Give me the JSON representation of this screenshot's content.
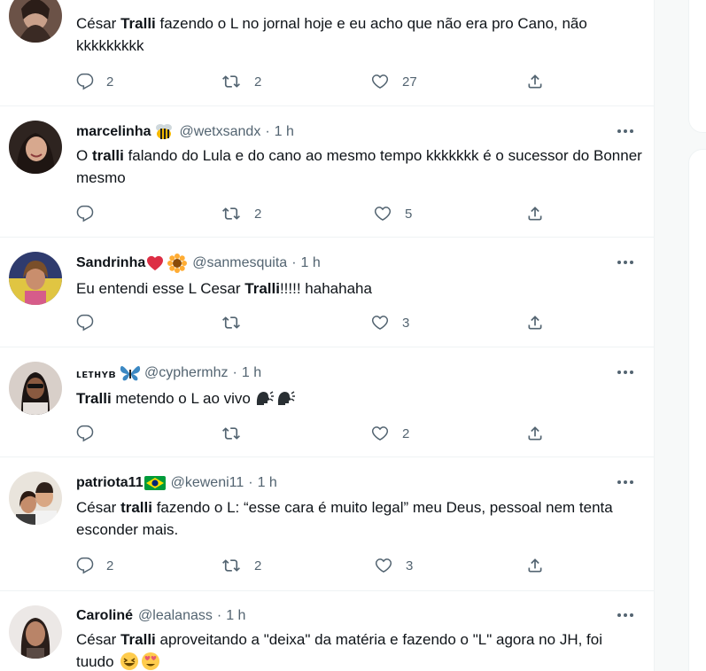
{
  "tweets": [
    {
      "name": "",
      "handle": "",
      "time": "",
      "text_parts": [
        {
          "t": "César ",
          "b": false
        },
        {
          "t": "Tralli",
          "b": true
        },
        {
          "t": " fazendo o L no jornal hoje e eu acho que não era pro Cano, não kkkkkkkkk",
          "b": false
        }
      ],
      "replies": "2",
      "retweets": "2",
      "likes": "27"
    },
    {
      "name": "marcelinha",
      "name_emoji": "bee",
      "handle": "@wetxsandx",
      "time": "1 h",
      "text_parts": [
        {
          "t": "O ",
          "b": false
        },
        {
          "t": "tralli",
          "b": true
        },
        {
          "t": " falando do Lula e do cano ao mesmo tempo kkkkkkk é o sucessor do Bonner mesmo",
          "b": false
        }
      ],
      "replies": "",
      "retweets": "2",
      "likes": "5"
    },
    {
      "name": "Sandrinha",
      "name_emoji": "heart-sunflower",
      "handle": "@sanmesquita",
      "time": "1 h",
      "text_parts": [
        {
          "t": "Eu entendi esse L Cesar ",
          "b": false
        },
        {
          "t": "Tralli",
          "b": true
        },
        {
          "t": "!!!!! hahahaha",
          "b": false
        }
      ],
      "replies": "",
      "retweets": "",
      "likes": "3"
    },
    {
      "name": "ʟᴇᴛʜʏʙ",
      "name_emoji": "butterfly",
      "handle": "@cyphermhz",
      "time": "1 h",
      "text_parts": [
        {
          "t": "Tralli",
          "b": true
        },
        {
          "t": " metendo o L ao vivo",
          "b": false
        }
      ],
      "text_emoji": "speaking-head",
      "replies": "",
      "retweets": "",
      "likes": "2"
    },
    {
      "name": "patriota11",
      "name_emoji": "brazil-flag",
      "handle": "@keweni11",
      "time": "1 h",
      "text_parts": [
        {
          "t": "César ",
          "b": false
        },
        {
          "t": "tralli",
          "b": true
        },
        {
          "t": " fazendo o L: “esse cara é muito legal” meu Deus, pessoal nem tenta esconder mais.",
          "b": false
        }
      ],
      "replies": "2",
      "retweets": "2",
      "likes": "3"
    },
    {
      "name": "Caroliné",
      "handle": "@lealanass",
      "time": "1 h",
      "text_parts": [
        {
          "t": "César ",
          "b": false
        },
        {
          "t": "Tralli",
          "b": true
        },
        {
          "t": " aproveitando a \"deixa\" da matéria e fazendo o \"L\" agora no JH, foi tuudo",
          "b": false
        }
      ],
      "text_emoji": "laughing-heart-eyes",
      "replies": "",
      "retweets": "",
      "likes": ""
    }
  ],
  "colors": {
    "text": "#0f1419",
    "secondary": "#536471",
    "divider": "#eff3f4"
  },
  "icons": {
    "reply": "reply-icon",
    "retweet": "retweet-icon",
    "like": "like-icon",
    "share": "share-icon",
    "more": "more-icon"
  }
}
